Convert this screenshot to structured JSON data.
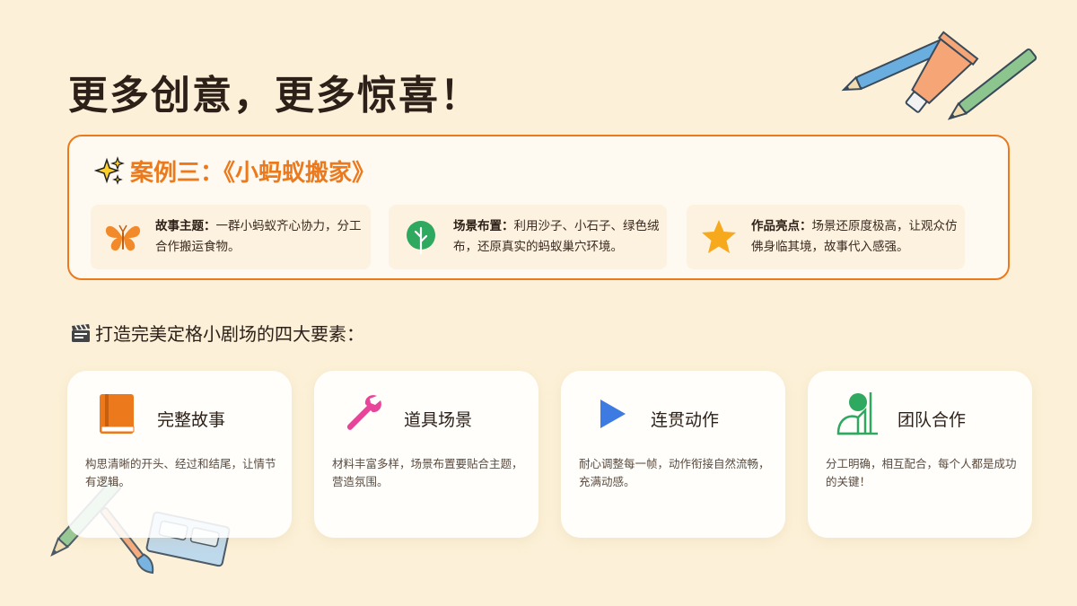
{
  "title": "更多创意，更多惊喜！",
  "case": {
    "title": "案例三：《小蚂蚁搬家》",
    "features": [
      {
        "icon": "butterfly-icon",
        "label": "故事主题：",
        "text": "一群小蚂蚁齐心协力，分工合作搬运食物。"
      },
      {
        "icon": "leaf-icon",
        "label": "场景布置：",
        "text": "利用沙子、小石子、绿色绒布，还原真实的蚂蚁巢穴环境。"
      },
      {
        "icon": "star-icon",
        "label": "作品亮点：",
        "text": "场景还原度极高，让观众仿佛身临其境，故事代入感强。"
      }
    ]
  },
  "section_title": "打造完美定格小剧场的四大要素：",
  "cards": [
    {
      "icon": "book-icon",
      "title": "完整故事",
      "desc": "构思清晰的开头、经过和结尾，让情节有逻辑。"
    },
    {
      "icon": "wrench-icon",
      "title": "道具场景",
      "desc": "材料丰富多样，场景布置要贴合主题，营造氛围。"
    },
    {
      "icon": "play-icon",
      "title": "连贯动作",
      "desc": "耐心调整每一帧，动作衔接自然流畅，充满动感。"
    },
    {
      "icon": "teamwork-icon",
      "title": "团队合作",
      "desc": "分工明确，相互配合，每个人都是成功的关键！"
    }
  ],
  "colors": {
    "background": "#fcf1d8",
    "accent": "#ec7a1d",
    "book": "#ec7a1d",
    "wrench": "#e8459a",
    "play": "#3d7be3",
    "teamwork": "#2fa860"
  }
}
